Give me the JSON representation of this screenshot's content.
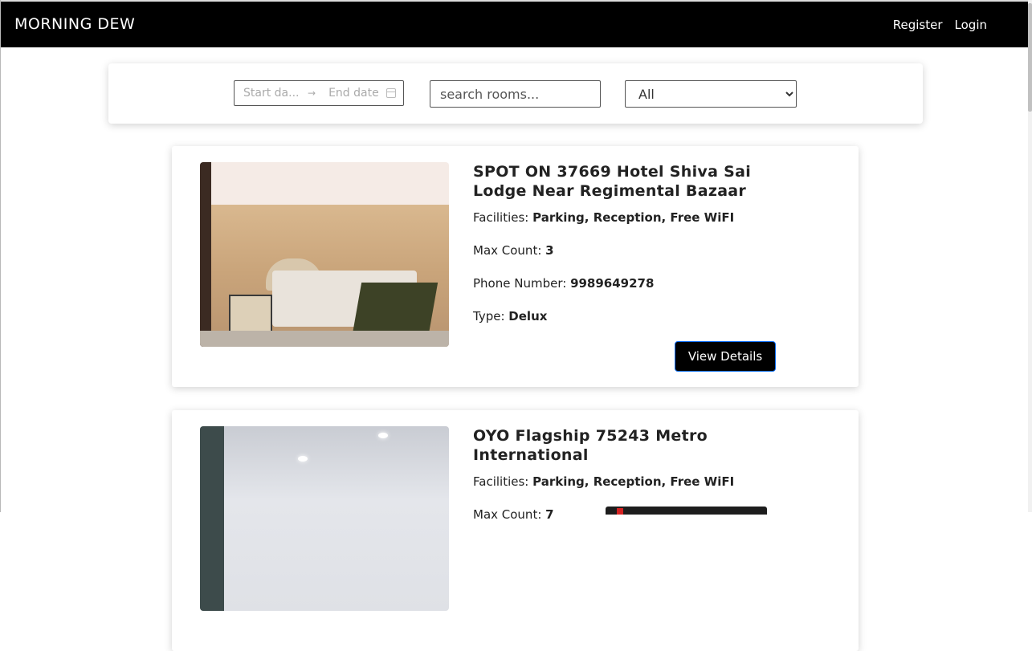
{
  "nav": {
    "brand": "MORNING DEW",
    "register_label": "Register",
    "login_label": "Login"
  },
  "filters": {
    "start_date_placeholder": "Start da...",
    "end_date_placeholder": "End date",
    "date_separator": "→",
    "search_placeholder": "search rooms...",
    "type_selected": "All"
  },
  "rooms": [
    {
      "name": "SPOT ON 37669 Hotel Shiva Sai Lodge Near Regimental Bazaar",
      "facilities_label": "Facilities:",
      "facilities": "Parking, Reception, Free WiFI",
      "max_count_label": "Max Count:",
      "max_count": "3",
      "phone_label": "Phone Number:",
      "phone": "9989649278",
      "type_label": "Type:",
      "type": "Delux",
      "view_button": "View Details"
    },
    {
      "name": "OYO Flagship 75243 Metro International",
      "facilities_label": "Facilities:",
      "facilities": "Parking, Reception, Free WiFI",
      "max_count_label": "Max Count:",
      "max_count": "7"
    }
  ],
  "colors": {
    "navbar_bg": "#000000",
    "button_bg": "#000000",
    "button_border": "#0d6efd"
  }
}
